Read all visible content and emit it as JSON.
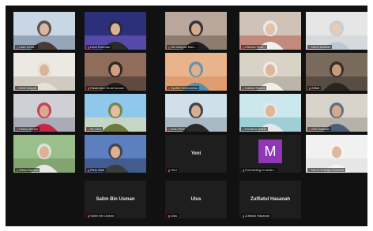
{
  "participants": [
    {
      "name": "Laila Cinta...",
      "scene": "room-blue"
    },
    {
      "name": "Dewi Rohmah",
      "scene": "galaxy"
    },
    {
      "name": "Siti Zakiyah Mas...",
      "scene": "room-warm"
    },
    {
      "name": "Hikmah Hida...",
      "scene": "room-red"
    },
    {
      "name": "Nurul Nafisah",
      "scene": "room-pale"
    },
    {
      "name": "Dewi Aisyah",
      "scene": "room-white"
    },
    {
      "name": "Hasanatun Nurul Isnaini",
      "scene": "room-purple"
    },
    {
      "name": "Syafitri Khoirunnisa",
      "scene": "room-orange"
    },
    {
      "name": "Lailatul Husna",
      "scene": "room-cream"
    },
    {
      "name": "Afifah",
      "scene": "room-dark"
    },
    {
      "name": "Fatwa Mimah",
      "scene": "room-mixed"
    },
    {
      "name": "Ita Citra",
      "scene": "beach"
    },
    {
      "name": "Anis Fitria",
      "scene": "window"
    },
    {
      "name": "Imroatus Saida",
      "scene": "room-teal"
    },
    {
      "name": "Sifa Nuaidah",
      "scene": "room-light"
    },
    {
      "name": "Siska Nurwati",
      "scene": "room-green"
    },
    {
      "name": "Fitria Wati",
      "scene": "sunset"
    },
    {
      "name": "Yeni",
      "center": "Yeni"
    },
    {
      "name": "Connecting to audio...",
      "avatar": "M"
    },
    {
      "name": "Nur'ul Chintya Ardriana",
      "scene": "white-wall"
    },
    {
      "name": "Salim Bin Usman",
      "center": "Salim Bin Usman"
    },
    {
      "name": "Ulus",
      "center": "Ulus"
    },
    {
      "name": "Zulfiatul Hasanah",
      "center": "Zulfiatul Hasanah"
    }
  ],
  "colors": {
    "background": "#111111",
    "tile": "#1e1e1e",
    "active_speaker_border": "#e6d64a",
    "muted_icon": "#e23b3b",
    "avatar_bg": "#8f37b7"
  }
}
